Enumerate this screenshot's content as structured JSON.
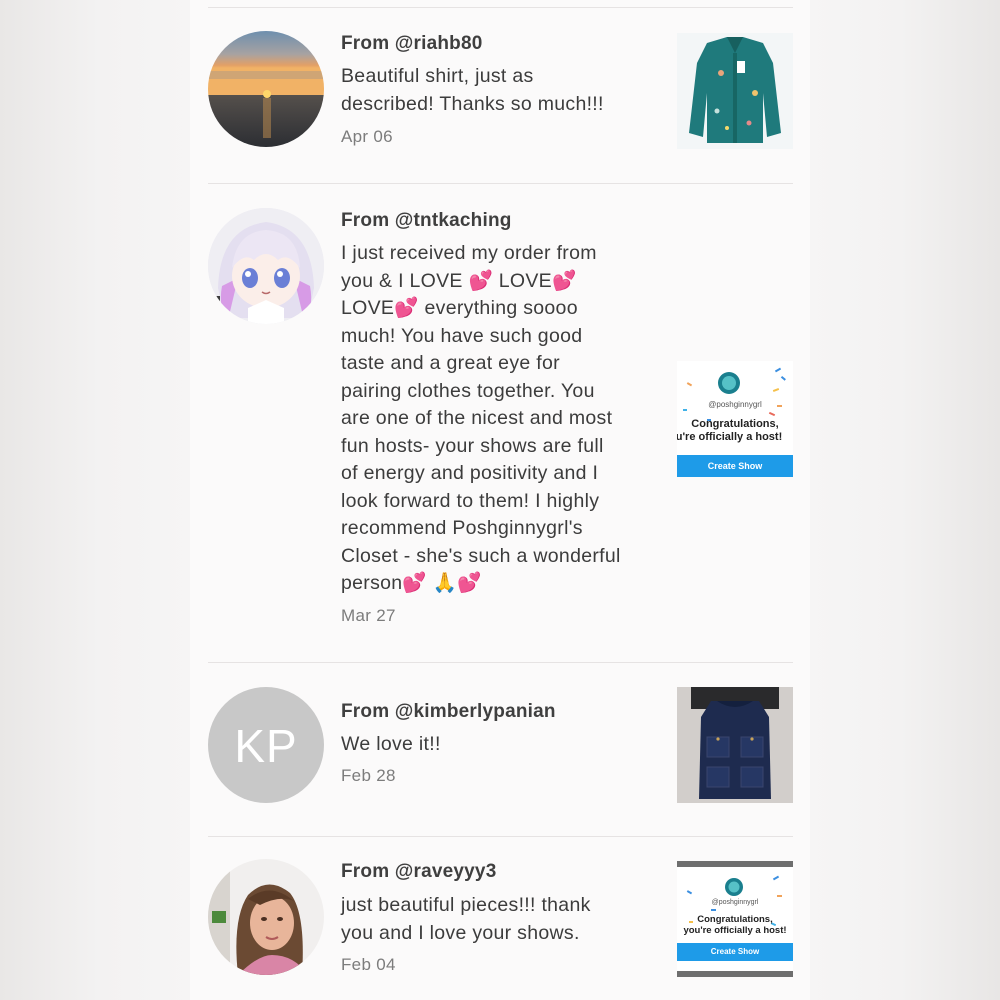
{
  "reviews": [
    {
      "from_prefix": "From ",
      "handle": "@riahb80",
      "body": "Beautiful shirt, just as\ndescribed! Thanks so much!!!",
      "date": "Apr 06",
      "avatar": "sunset-photo",
      "thumb": "teal-shirt-photo"
    },
    {
      "from_prefix": "From ",
      "handle": "@tntkaching",
      "body": "I just received my order from\nyou & I LOVE 💕 LOVE💕\nLOVE💕 everything soooo\nmuch! You have such good\ntaste and a great eye for\npairing clothes together. You\nare one of the nicest and most\nfun hosts- your shows are full\nof energy and positivity and I\nlook forward to them! I highly\nrecommend Poshginnygrl's\nCloset - she's such a wonderful\nperson💕 🙏💕",
      "date": "Mar 27",
      "avatar": "anime-girl-avatar",
      "thumb": "host-congrats-card"
    },
    {
      "from_prefix": "From ",
      "handle": "@kimberlypanian",
      "body": "We love it!!",
      "date": "Feb 28",
      "avatar_initials": "KP",
      "thumb": "denim-vest-photo"
    },
    {
      "from_prefix": "From ",
      "handle": "@raveyyy3",
      "body": "just beautiful pieces!!! thank\nyou and I love your shows.",
      "date": "Feb 04",
      "avatar": "woman-portrait-photo",
      "thumb": "host-congrats-card-small"
    }
  ],
  "host_card": {
    "handle": "@poshginnygrl",
    "congrats_line1": "Congratulations,",
    "congrats_line2": "you're officially a host!",
    "congrats_line2_clipped": "ou're officially a host!",
    "button": "Create Show"
  },
  "colors": {
    "panel": "#fbfafa",
    "text": "#3c3c3c",
    "date": "#7c7c7c",
    "kp_avatar": "#c8c8c8",
    "create_button": "#1e9be8"
  }
}
